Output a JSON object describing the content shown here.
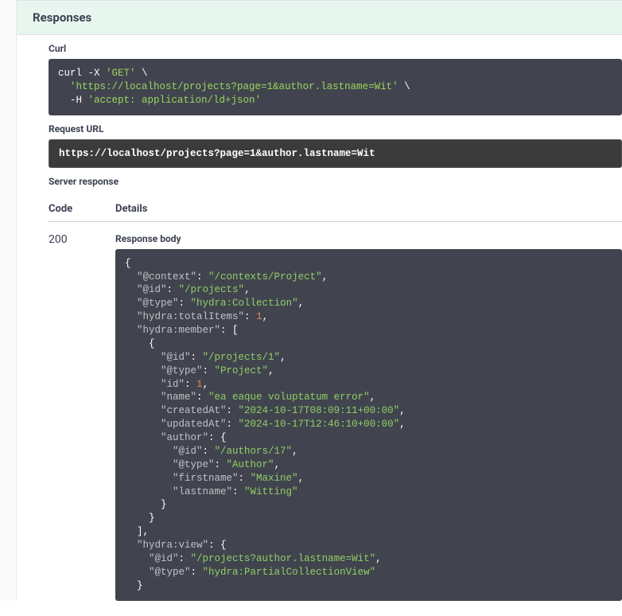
{
  "header": {
    "title": "Responses"
  },
  "curl": {
    "label": "Curl",
    "line1a": "curl -X ",
    "line1b": "'GET'",
    "line1c": " \\",
    "line2a": "  ",
    "line2b": "'https://localhost/projects?page=1&author.lastname=Wit'",
    "line2c": " \\",
    "line3a": "  -H ",
    "line3b": "'accept: application/ld+json'"
  },
  "request_url": {
    "label": "Request URL",
    "value": "https://localhost/projects?page=1&author.lastname=Wit"
  },
  "server_response": {
    "label": "Server response",
    "code_header": "Code",
    "details_header": "Details",
    "code": "200",
    "response_body_label": "Response body"
  },
  "json_body": {
    "l1": "{",
    "l2k": "\"@context\"",
    "l2c": ": ",
    "l2v": "\"/contexts/Project\"",
    "l2e": ",",
    "l3k": "\"@id\"",
    "l3c": ": ",
    "l3v": "\"/projects\"",
    "l3e": ",",
    "l4k": "\"@type\"",
    "l4c": ": ",
    "l4v": "\"hydra:Collection\"",
    "l4e": ",",
    "l5k": "\"hydra:totalItems\"",
    "l5c": ": ",
    "l5v": "1",
    "l5e": ",",
    "l6k": "\"hydra:member\"",
    "l6c": ": [",
    "l7": "    {",
    "l8k": "\"@id\"",
    "l8c": ": ",
    "l8v": "\"/projects/1\"",
    "l8e": ",",
    "l9k": "\"@type\"",
    "l9c": ": ",
    "l9v": "\"Project\"",
    "l9e": ",",
    "l10k": "\"id\"",
    "l10c": ": ",
    "l10v": "1",
    "l10e": ",",
    "l11k": "\"name\"",
    "l11c": ": ",
    "l11v": "\"ea eaque voluptatum error\"",
    "l11e": ",",
    "l12k": "\"createdAt\"",
    "l12c": ": ",
    "l12v": "\"2024-10-17T08:09:11+00:00\"",
    "l12e": ",",
    "l13k": "\"updatedAt\"",
    "l13c": ": ",
    "l13v": "\"2024-10-17T12:46:10+00:00\"",
    "l13e": ",",
    "l14k": "\"author\"",
    "l14c": ": {",
    "l15k": "\"@id\"",
    "l15c": ": ",
    "l15v": "\"/authors/17\"",
    "l15e": ",",
    "l16k": "\"@type\"",
    "l16c": ": ",
    "l16v": "\"Author\"",
    "l16e": ",",
    "l17k": "\"firstname\"",
    "l17c": ": ",
    "l17v": "\"Maxine\"",
    "l17e": ",",
    "l18k": "\"lastname\"",
    "l18c": ": ",
    "l18v": "\"Witting\"",
    "l19": "      }",
    "l20": "    }",
    "l21": "  ],",
    "l22k": "\"hydra:view\"",
    "l22c": ": {",
    "l23k": "\"@id\"",
    "l23c": ": ",
    "l23v": "\"/projects?author.lastname=Wit\"",
    "l23e": ",",
    "l24k": "\"@type\"",
    "l24c": ": ",
    "l24v": "\"hydra:PartialCollectionView\"",
    "l25": "  }"
  }
}
